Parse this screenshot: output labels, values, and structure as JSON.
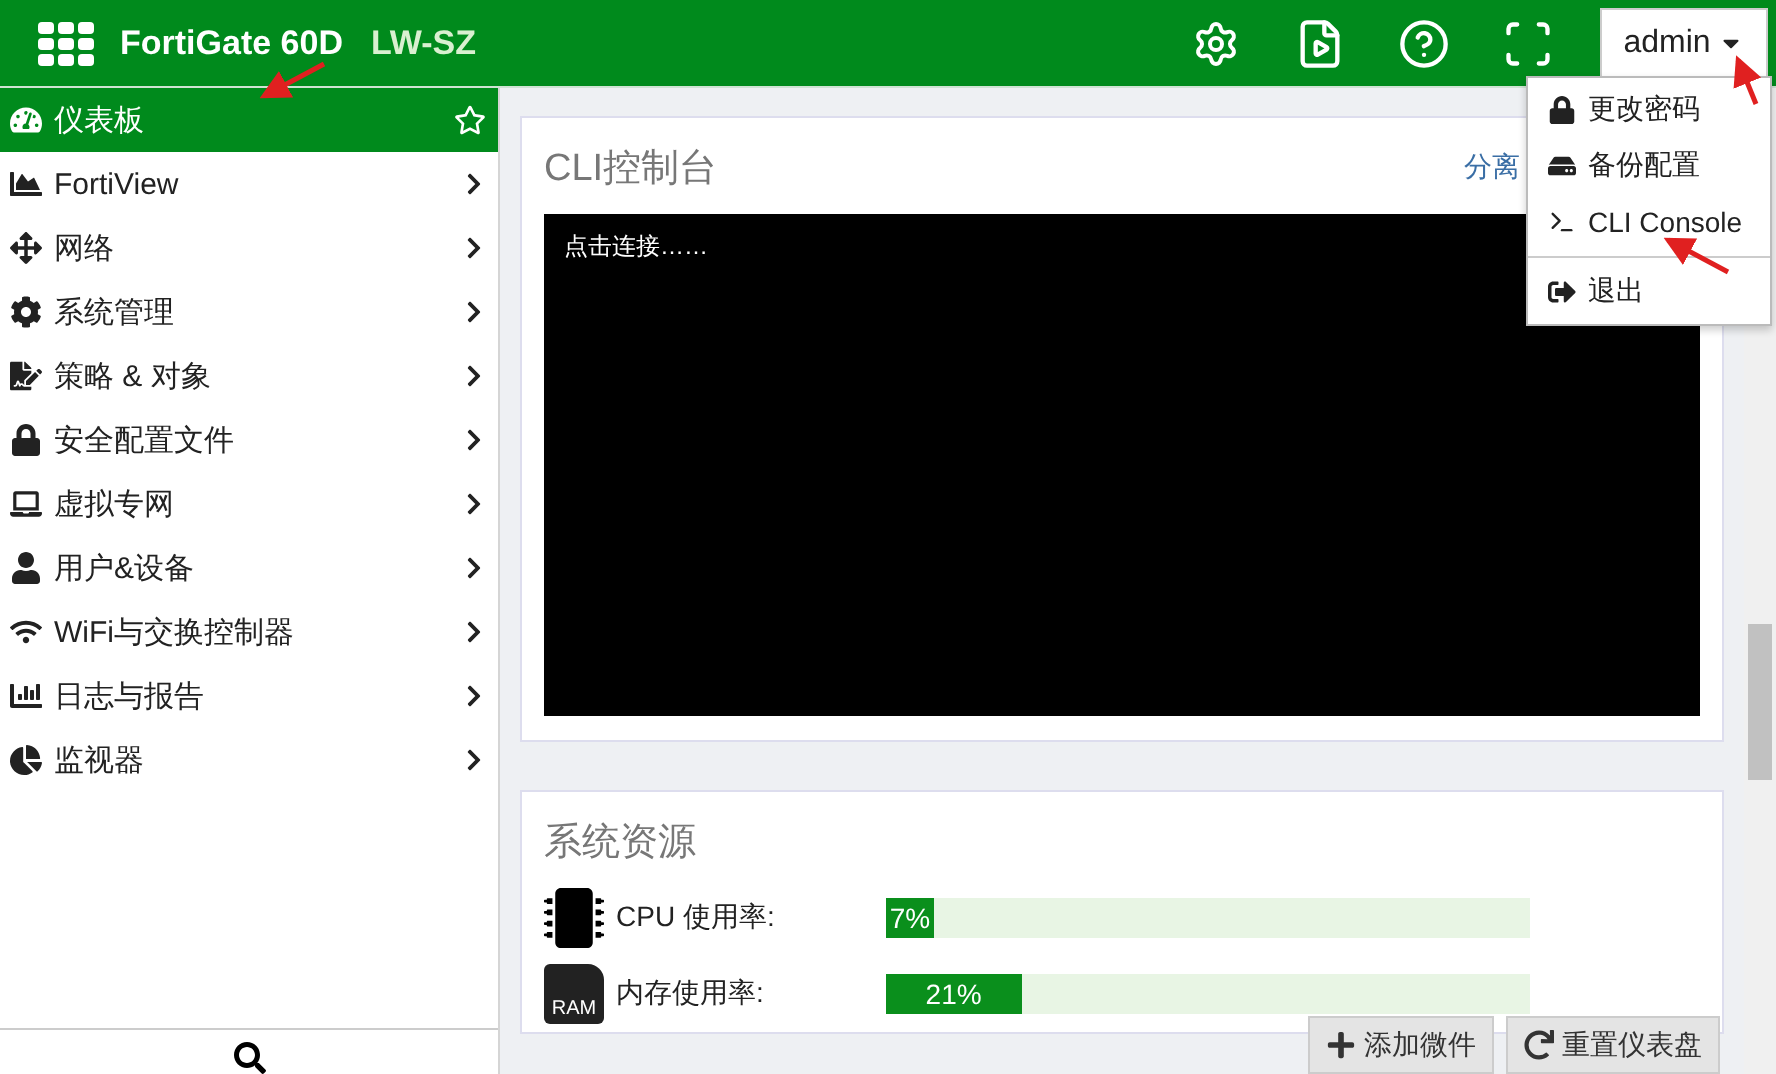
{
  "header": {
    "product": "FortiGate 60D",
    "hostname": "LW-SZ",
    "user": "admin"
  },
  "user_menu": {
    "open": true,
    "items": [
      {
        "label": "更改密码",
        "kind": "lock"
      },
      {
        "label": "备份配置",
        "kind": "drive"
      },
      {
        "label": "CLI Console",
        "kind": "terminal"
      },
      {
        "label": "退出",
        "kind": "logout"
      }
    ]
  },
  "sidebar": {
    "items": [
      {
        "label": "仪表板",
        "selected": true,
        "favorite": false
      },
      {
        "label": "FortiView",
        "selected": false
      },
      {
        "label": "网络",
        "selected": false
      },
      {
        "label": "系统管理",
        "selected": false
      },
      {
        "label": "策略 & 对象",
        "selected": false
      },
      {
        "label": "安全配置文件",
        "selected": false
      },
      {
        "label": "虚拟专网",
        "selected": false
      },
      {
        "label": "用户&设备",
        "selected": false
      },
      {
        "label": "WiFi与交换控制器",
        "selected": false
      },
      {
        "label": "日志与报告",
        "selected": false
      },
      {
        "label": "监视器",
        "selected": false
      }
    ]
  },
  "cli_widget": {
    "title": "CLI控制台",
    "detach_link": "分离",
    "terminal_text": "点击连接……"
  },
  "resources_widget": {
    "title": "系统资源",
    "ram_icon_label": "RAM",
    "meters": [
      {
        "kind": "cpu",
        "label": "CPU 使用率:",
        "level": 0.07,
        "reading": "7%"
      },
      {
        "kind": "ram",
        "label": "内存使用率:",
        "level": 0.21,
        "reading": "21%"
      }
    ]
  },
  "footer_buttons": [
    {
      "label": "添加微件",
      "kind": "add"
    },
    {
      "label": "重置仪表盘",
      "kind": "reset"
    }
  ]
}
